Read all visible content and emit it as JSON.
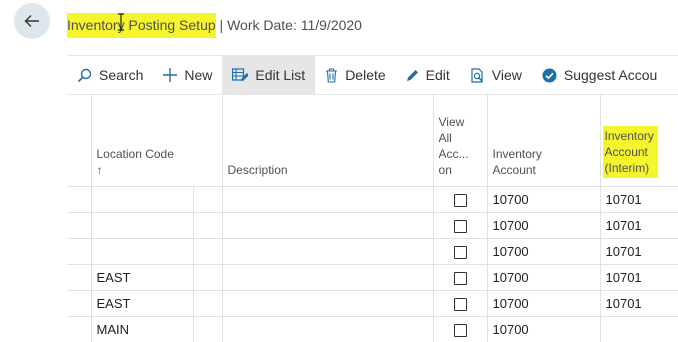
{
  "header": {
    "title_highlighted": "Inventory Posting Setup",
    "title_rest": " | Work Date: 11/9/2020"
  },
  "toolbar": {
    "search": "Search",
    "new": "New",
    "edit_list": "Edit List",
    "delete": "Delete",
    "edit": "Edit",
    "view": "View",
    "suggest": "Suggest Accou"
  },
  "columns": {
    "location_code": "Location Code",
    "sort_indicator": "↑",
    "description": "Description",
    "view_all": "View All Acc... on",
    "inventory_account": "Inventory Account",
    "inventory_interim": "Inventory Account (Interim)"
  },
  "rows": [
    {
      "location": "",
      "inv": "10700",
      "interim": "10701"
    },
    {
      "location": "",
      "inv": "10700",
      "interim": "10701"
    },
    {
      "location": "",
      "inv": "10700",
      "interim": "10701"
    },
    {
      "location": "EAST",
      "inv": "10700",
      "interim": "10701"
    },
    {
      "location": "EAST",
      "inv": "10700",
      "interim": "10701"
    },
    {
      "location": "MAIN",
      "inv": "10700",
      "interim": ""
    }
  ],
  "colors": {
    "highlight": "#f5f52e",
    "back_button_bg": "#dfe7ec",
    "active_tab_bg": "#e6e6e6"
  }
}
